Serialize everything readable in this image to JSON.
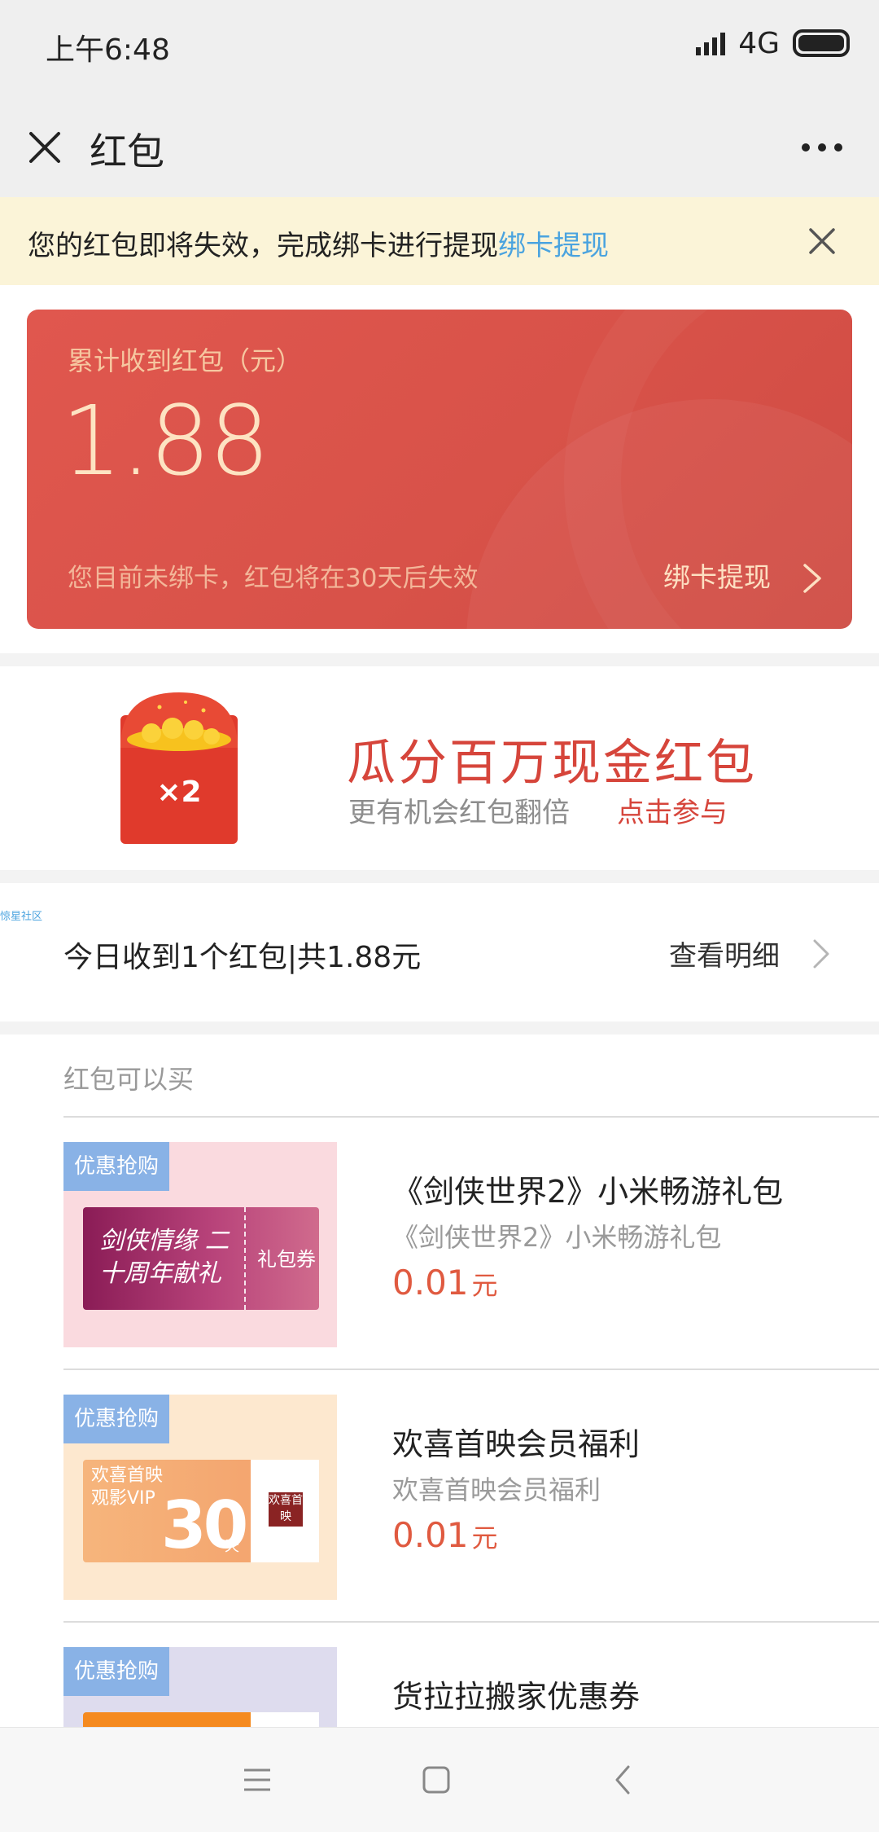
{
  "status_bar": {
    "time": "上午6:48",
    "network": "4G",
    "icons": [
      "signal-icon",
      "battery-icon"
    ]
  },
  "header": {
    "title": "红包",
    "icons": [
      "close-icon",
      "more-icon"
    ]
  },
  "notice": {
    "text": "您的红包即将失效，完成绑卡进行提现",
    "link": "绑卡提现"
  },
  "summary_card": {
    "label": "累计收到红包（元）",
    "amount": "1.88",
    "hint": "您目前未绑卡，红包将在30天后失效",
    "action": "绑卡提现"
  },
  "banner": {
    "headline": "瓜分百万现金红包",
    "sub": "更有机会红包翻倍",
    "cta": "点击参与",
    "envelope_badge": "×2"
  },
  "today": {
    "tiny_label": "惊星社区",
    "text": "今日收到1个红包|共1.88元",
    "detail": "查看明细"
  },
  "shop": {
    "section_title": "红包可以买",
    "items": [
      {
        "tag": "优惠抢购",
        "name": "《剑侠世界2》小米畅游礼包",
        "desc": "《剑侠世界2》小米畅游礼包",
        "price": "0.01",
        "unit": "元",
        "thumb_text": "剑侠情缘 二十周年献礼",
        "thumb_label": "礼包券"
      },
      {
        "tag": "优惠抢购",
        "name": "欢喜首映会员福利",
        "desc": "欢喜首映会员福利",
        "price": "0.01",
        "unit": "元",
        "thumb_text": "欢喜首映 观影VIP",
        "thumb_big": "30",
        "thumb_day": "天",
        "thumb_logo": "欢喜首映"
      },
      {
        "tag": "优惠抢购",
        "name": "货拉拉搬家优惠券"
      }
    ]
  },
  "nav_bar": {
    "icons": [
      "menu-icon",
      "home-icon",
      "back-icon"
    ]
  },
  "colors": {
    "accent_red": "#d6453b",
    "link_blue": "#4aa3df",
    "card_red": "#d85249",
    "price": "#e05a40",
    "tag_blue": "#89b2e6"
  }
}
